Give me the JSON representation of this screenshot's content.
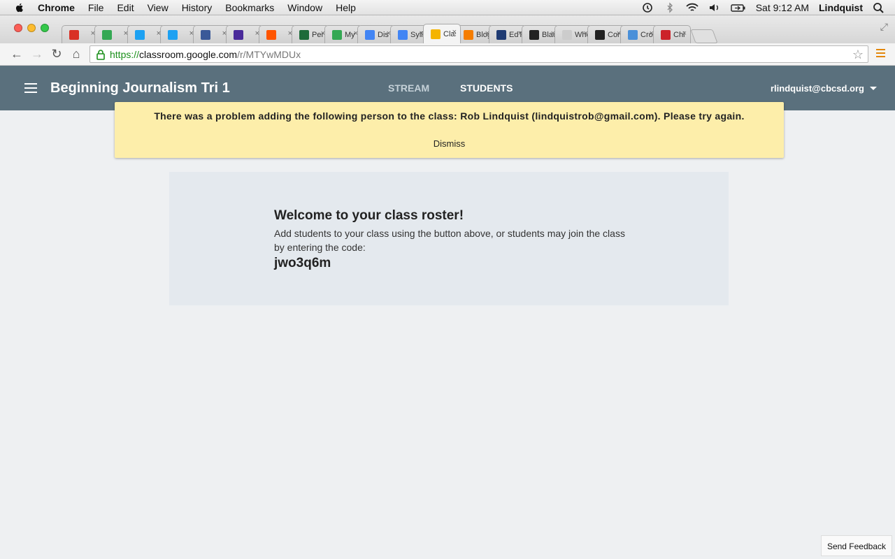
{
  "menubar": {
    "app": "Chrome",
    "items": [
      "File",
      "Edit",
      "View",
      "History",
      "Bookmarks",
      "Window",
      "Help"
    ],
    "clock": "Sat 9:12 AM",
    "user": "Lindquist"
  },
  "tabs": [
    {
      "icon": "gmail-icon",
      "title": "",
      "color": "#d93025"
    },
    {
      "icon": "drive-icon",
      "title": "",
      "color": "#34a853"
    },
    {
      "icon": "twitter-icon",
      "title": "",
      "color": "#1da1f2"
    },
    {
      "icon": "twitter-icon",
      "title": "",
      "color": "#1da1f2"
    },
    {
      "icon": "facebook-icon",
      "title": "",
      "color": "#3b5998"
    },
    {
      "icon": "mail-icon",
      "title": "",
      "color": "#4a2a9a"
    },
    {
      "icon": "soundcloud-icon",
      "title": "",
      "color": "#ff5500"
    },
    {
      "icon": "perusall-icon",
      "title": "Per",
      "color": "#1e6b3a"
    },
    {
      "icon": "drive-icon",
      "title": "My",
      "color": "#34a853"
    },
    {
      "icon": "docs-icon",
      "title": "Dis",
      "color": "#4285f4"
    },
    {
      "icon": "docs-icon",
      "title": "Syll",
      "color": "#4285f4"
    },
    {
      "icon": "classroom-icon",
      "title": "Clas",
      "color": "#f4b400",
      "active": true
    },
    {
      "icon": "blogger-icon",
      "title": "Blog",
      "color": "#f57d00"
    },
    {
      "icon": "edtech-icon",
      "title": "EdT",
      "color": "#1f3b73"
    },
    {
      "icon": "blackboard-icon",
      "title": "Blac",
      "color": "#222222"
    },
    {
      "icon": "page-icon",
      "title": "Whe",
      "color": "#cccccc"
    },
    {
      "icon": "amazon-icon",
      "title": "Con",
      "color": "#222222"
    },
    {
      "icon": "loading-icon",
      "title": "Cro",
      "color": "#4a90d9"
    },
    {
      "icon": "chrome-c-icon",
      "title": "Chi",
      "color": "#cc2229"
    }
  ],
  "url": {
    "protocol": "https://",
    "host": "classroom.google.com",
    "path": "/r/MTYwMDUx"
  },
  "app": {
    "class_title": "Beginning Journalism  Tri 1",
    "tab_stream": "STREAM",
    "tab_students": "STUDENTS",
    "account": "rlindquist@cbcsd.org"
  },
  "banner": {
    "message": "There was a problem adding the following person to the class: Rob Lindquist (lindquistrob@gmail.com). Please try again.",
    "dismiss": "Dismiss"
  },
  "roster": {
    "heading": "Welcome to your class roster!",
    "body": "Add students to your class using the button above, or students may join the class by entering the code:",
    "code": "jwo3q6m"
  },
  "feedback": "Send Feedback"
}
